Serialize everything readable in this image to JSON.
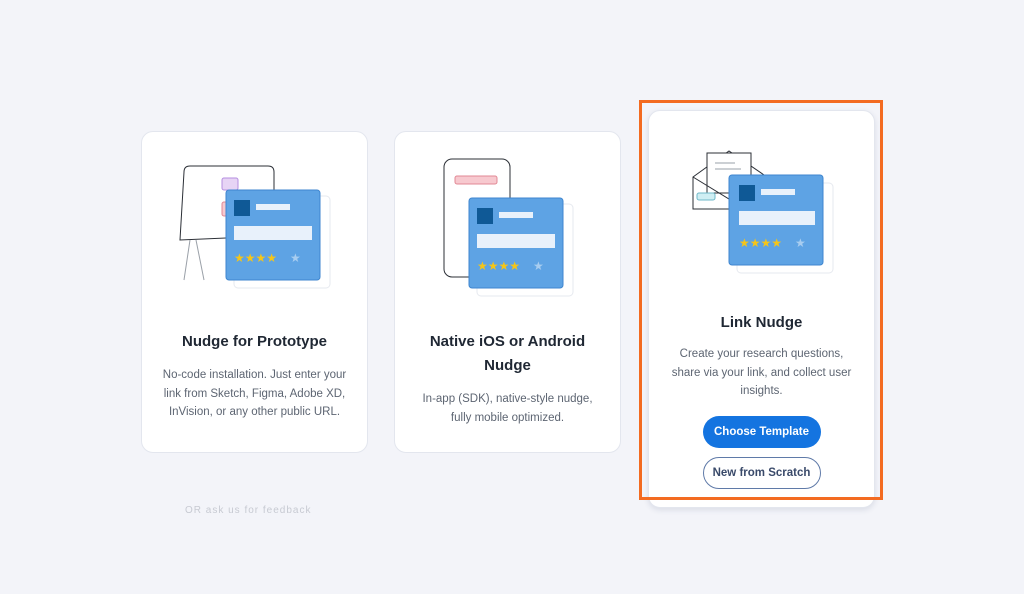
{
  "cards": [
    {
      "title": "Nudge for Prototype",
      "description": "No-code installation. Just enter your link from Sketch, Figma, Adobe XD, InVision, or any other public URL."
    },
    {
      "title": "Native iOS or Android Nudge",
      "description": "In-app (SDK), native-style nudge, fully mobile optimized."
    },
    {
      "title": "Link Nudge",
      "description": "Create your research questions, share via your link, and collect user insights.",
      "primary_button": "Choose Template",
      "secondary_button": "New from Scratch"
    }
  ],
  "footer_faded": "OR ask us for feedback",
  "colors": {
    "primary": "#1474e0",
    "highlight": "#f36b21",
    "illustration_card": "#5ea3e4",
    "star": "#f5c518"
  }
}
